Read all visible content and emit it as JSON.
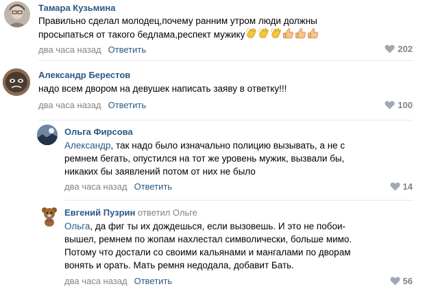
{
  "comments": [
    {
      "author": "Тамара Кузьмина",
      "text_lines": [
        "Правильно сделал молодец,почему ранним утром люди должны",
        "просыпаться от такого бедлама,респект мужику"
      ],
      "emojis": [
        "clapping-hands-icon",
        "clapping-hands-icon",
        "clapping-hands-icon",
        "thumbs-up-icon",
        "thumbs-up-icon",
        "thumbs-up-icon"
      ],
      "time": "два часа назад",
      "reply_label": "Ответить",
      "likes": "202"
    },
    {
      "author": "Александр Берестов",
      "text_lines": [
        "надо всем двором на девушек написать заяву в ответку!!!"
      ],
      "time": "два часа назад",
      "reply_label": "Ответить",
      "likes": "100"
    },
    {
      "author": "Ольга Фирсова",
      "mention": "Александр",
      "text_lines": [
        ", так надо было изначально полицию вызывать, а не с",
        "ремнем бегать, опустился на тот же уровень мужик, вызвали бы,",
        "никаких бы заявлений потом от них не было"
      ],
      "time": "два часа назад",
      "reply_label": "Ответить",
      "likes": "14"
    },
    {
      "author": "Евгений Пузрин",
      "replied_to": "ответил Ольге",
      "mention": "Ольга",
      "text_lines": [
        ", да фиг ты их дождешься, если вызовешь. И это не побои-",
        "вышел, ремнем по жопам нахлестал символически, больше мимо.",
        "Потому что достали со своими кальянами и мангалами по дворам",
        "вонять и орать. Мать ремня недодала, добавит Бать."
      ],
      "time": "два часа назад",
      "reply_label": "Ответить",
      "likes": "56"
    }
  ],
  "colors": {
    "link": "#2a5885",
    "meta": "#828282",
    "divider": "#e7e8ec"
  }
}
